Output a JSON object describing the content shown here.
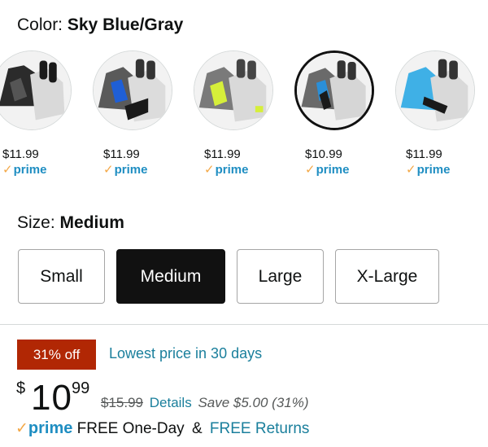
{
  "color": {
    "label": "Color:",
    "value": "Sky Blue/Gray"
  },
  "swatches": [
    {
      "price": "$11.99",
      "prime": "prime",
      "accent": "#1a1a1a"
    },
    {
      "price": "$11.99",
      "prime": "prime",
      "accent": "#1f5fd6"
    },
    {
      "price": "$11.99",
      "prime": "prime",
      "accent": "#d6ef3a"
    },
    {
      "price": "$10.99",
      "prime": "prime",
      "accent": "#2a8fd8",
      "selected": true
    },
    {
      "price": "$11.99",
      "prime": "prime",
      "accent": "#3fb0e6"
    }
  ],
  "size": {
    "label": "Size:",
    "value": "Medium"
  },
  "size_options": [
    "Small",
    "Medium",
    "Large",
    "X-Large"
  ],
  "deal": {
    "badge": "31% off",
    "text": "Lowest price in 30 days"
  },
  "price": {
    "symbol": "$",
    "whole": "10",
    "fraction": "99"
  },
  "list_price": {
    "was": "$15.99",
    "details": "Details",
    "save": "Save $5.00 (31%)"
  },
  "shipping": {
    "check": "✓",
    "prime": "prime",
    "free": "FREE One-Day",
    "amp": "&",
    "returns": "FREE Returns"
  },
  "colors": {
    "deal_red": "#b12704",
    "link": "#1a7f9c",
    "prime_blue": "#1f8ec2",
    "prime_check": "#f3a847"
  }
}
